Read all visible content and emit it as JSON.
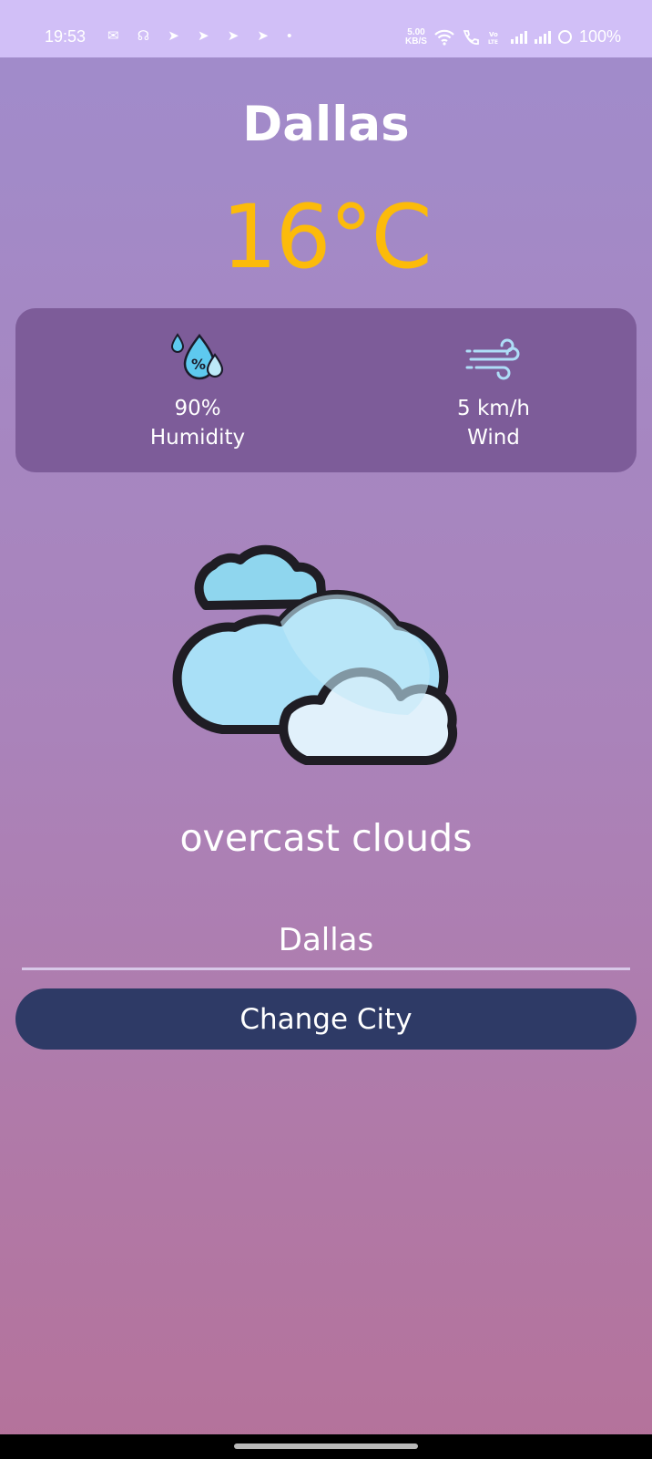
{
  "status_bar": {
    "time": "19:53",
    "net_speed_value": "5.00",
    "net_speed_unit": "KB/S",
    "battery": "100%"
  },
  "weather": {
    "city": "Dallas",
    "temperature": "16°C",
    "humidity_value": "90%",
    "humidity_label": "Humidity",
    "wind_value": "5 km/h",
    "wind_label": "Wind",
    "description": "overcast clouds",
    "icon": "overcast-clouds-icon"
  },
  "form": {
    "city_input_value": "Dallas",
    "button_label": "Change City"
  },
  "colors": {
    "temperature": "#fcbb0a",
    "card": "#7d5c99",
    "button": "#2e3a66",
    "status_bar": "#d1bff7"
  }
}
